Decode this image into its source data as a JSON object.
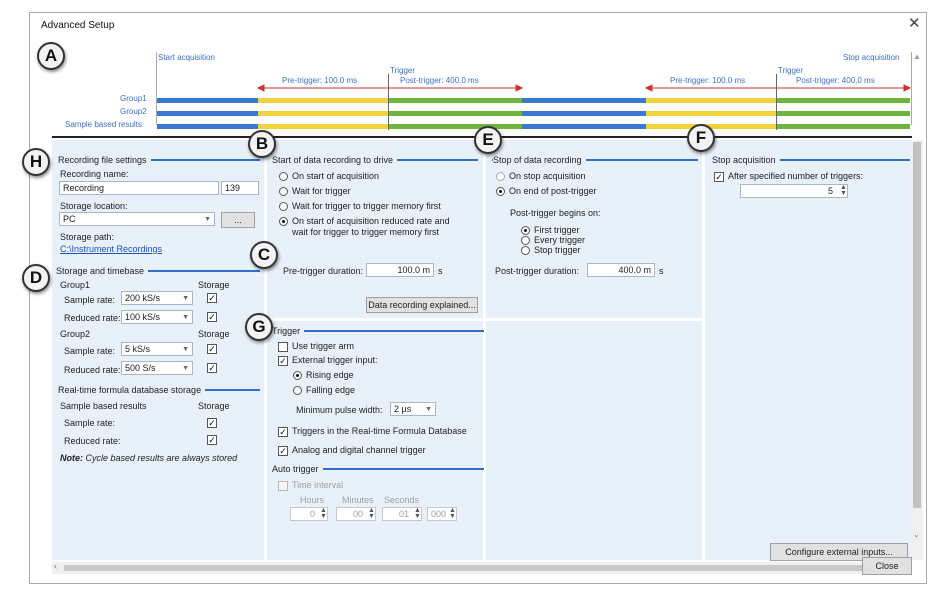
{
  "window": {
    "title": "Advanced Setup",
    "close_glyph": "✕",
    "close_button": "Close"
  },
  "callouts": {
    "A": "A",
    "B": "B",
    "C": "C",
    "D": "D",
    "E": "E",
    "F": "F",
    "G": "G",
    "H": "H"
  },
  "timeline": {
    "start_acquisition": "Start acquisition",
    "stop_acquisition": "Stop acquisition",
    "trigger": "Trigger",
    "pre_trigger": "Pre-trigger: 100.0 ms",
    "post_trigger": "Post-trigger: 400.0 ms",
    "rows": [
      "Group1",
      "Group2",
      "Sample based results"
    ],
    "colors": {
      "blue": "#3b78cf",
      "yellow": "#f2d23a",
      "green": "#6fb43f",
      "red": "#d03030"
    }
  },
  "recording_file": {
    "title": "Recording file settings",
    "name_label": "Recording name:",
    "name_value": "Recording",
    "name_counter": "139",
    "storage_location_label": "Storage location:",
    "storage_location_value": "PC",
    "browse_label": "...",
    "storage_path_label": "Storage path:",
    "storage_path_value": "C:\\Instrument Recordings"
  },
  "storage_timebase": {
    "title": "Storage and timebase",
    "storage_header": "Storage",
    "group1": {
      "label": "Group1",
      "sample_rate_label": "Sample rate:",
      "sample_rate": "200 kS/s",
      "reduced_rate_label": "Reduced rate:",
      "reduced_rate": "100 kS/s"
    },
    "group2": {
      "label": "Group2",
      "sample_rate_label": "Sample rate:",
      "sample_rate": "5 kS/s",
      "reduced_rate_label": "Reduced rate:",
      "reduced_rate": "500 S/s"
    }
  },
  "formula_storage": {
    "title": "Real-time formula database storage",
    "sample_based": "Sample based results",
    "storage_header": "Storage",
    "sample_rate_label": "Sample rate:",
    "reduced_rate_label": "Reduced rate:",
    "note_bold": "Note:",
    "note_text": "Cycle based results are always stored"
  },
  "start_recording": {
    "title": "Start of data recording to drive",
    "options": [
      "On start of acquisition",
      "Wait for trigger",
      "Wait for trigger to trigger memory first",
      "On start of acquisition reduced rate and",
      "wait for trigger to trigger memory first"
    ],
    "pretrigger_label": "Pre-trigger duration:",
    "pretrigger_value": "100.0 m",
    "pretrigger_unit": "s",
    "explained_button": "Data recording explained..."
  },
  "stop_recording": {
    "title": "Stop of data recording",
    "options": [
      "On stop acquisition",
      "On end of post-trigger"
    ],
    "post_begins_label": "Post-trigger begins on:",
    "post_begins_options": [
      "First trigger",
      "Every trigger",
      "Stop trigger"
    ],
    "post_duration_label": "Post-trigger duration:",
    "post_duration_value": "400.0 m",
    "post_duration_unit": "s"
  },
  "stop_acquisition": {
    "title": "Stop acquisition",
    "after_triggers_label": "After specified number of triggers:",
    "after_triggers_value": "5",
    "configure_button": "Configure external inputs..."
  },
  "trigger": {
    "title": "Trigger",
    "use_arm": "Use trigger arm",
    "external_input": "External trigger input:",
    "rising": "Rising edge",
    "falling": "Falling edge",
    "min_pulse_label": "Minimum pulse width:",
    "min_pulse_value": "2 µs",
    "formula_triggers": "Triggers in the Real-time Formula Database",
    "analog_digital": "Analog and digital channel trigger"
  },
  "auto_trigger": {
    "title": "Auto trigger",
    "time_interval": "Time interval",
    "hours_label": "Hours",
    "minutes_label": "Minutes",
    "seconds_label": "Seconds",
    "hours": "0",
    "minutes": "00",
    "seconds": "01",
    "millis": "000"
  }
}
